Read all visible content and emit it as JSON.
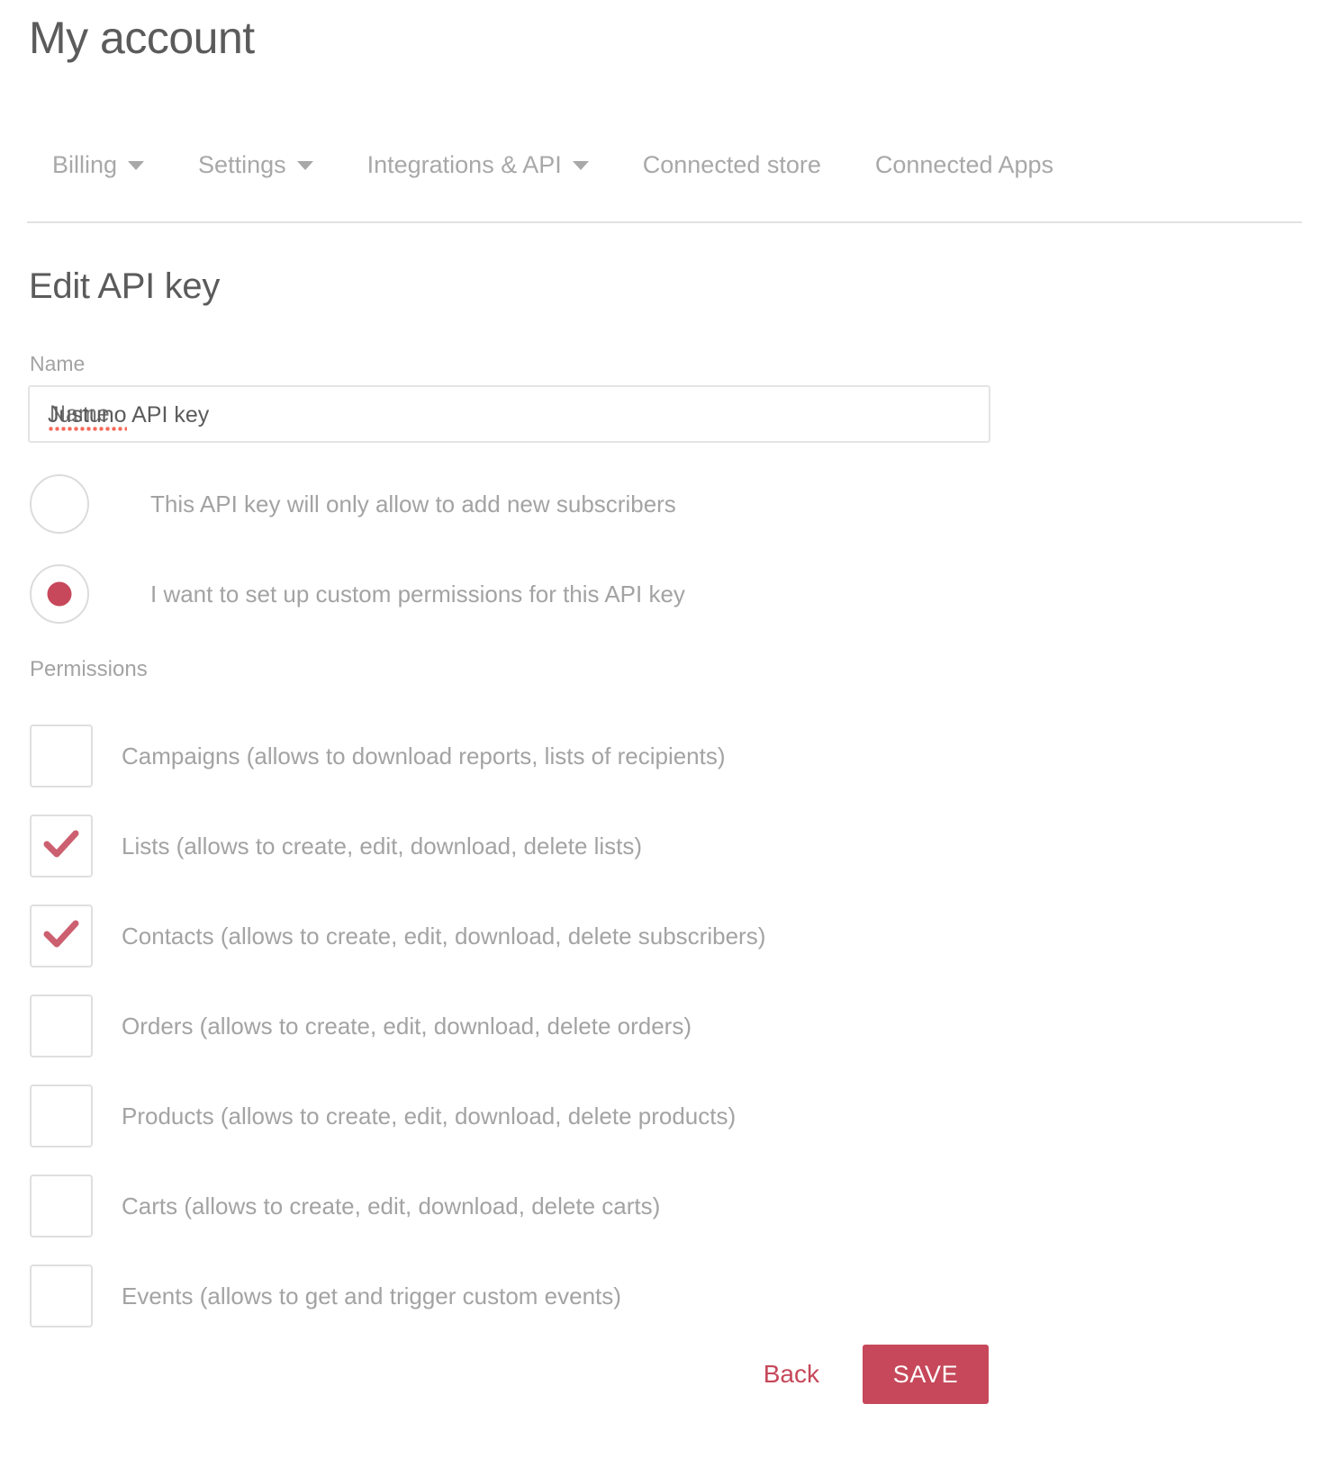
{
  "header": {
    "title": "My account"
  },
  "tabs": [
    {
      "label": "Billing",
      "has_caret": true
    },
    {
      "label": "Settings",
      "has_caret": true
    },
    {
      "label": "Integrations & API",
      "has_caret": true
    },
    {
      "label": "Connected store",
      "has_caret": false
    },
    {
      "label": "Connected Apps",
      "has_caret": false
    }
  ],
  "form": {
    "section_title": "Edit API key",
    "name_label": "Name",
    "name_value": "Justuno API key",
    "name_placeholder": "Name",
    "misspelled_word": "Justuno",
    "name_value_rest": " API key",
    "radios": [
      {
        "label": "This API key will only allow to add new subscribers",
        "selected": false
      },
      {
        "label": "I want to set up custom permissions for this API key",
        "selected": true
      }
    ],
    "permissions_label": "Permissions",
    "permissions": [
      {
        "label": "Campaigns (allows to download reports, lists of recipients)",
        "checked": false
      },
      {
        "label": "Lists (allows to create, edit, download, delete lists)",
        "checked": true
      },
      {
        "label": "Contacts (allows to create, edit, download, delete subscribers)",
        "checked": true
      },
      {
        "label": "Orders (allows to create, edit, download, delete orders)",
        "checked": false
      },
      {
        "label": "Products (allows to create, edit, download, delete products)",
        "checked": false
      },
      {
        "label": "Carts (allows to create, edit, download, delete carts)",
        "checked": false
      },
      {
        "label": "Events (allows to get and trigger custom events)",
        "checked": false
      }
    ]
  },
  "actions": {
    "back_label": "Back",
    "save_label": "SAVE"
  },
  "colors": {
    "accent": "#c6485a",
    "check": "#cc6070",
    "text_muted": "#a3a3a3",
    "text_dark": "#5b5b5b",
    "border": "#e2e2e2",
    "spellcheck": "#f4695a"
  }
}
